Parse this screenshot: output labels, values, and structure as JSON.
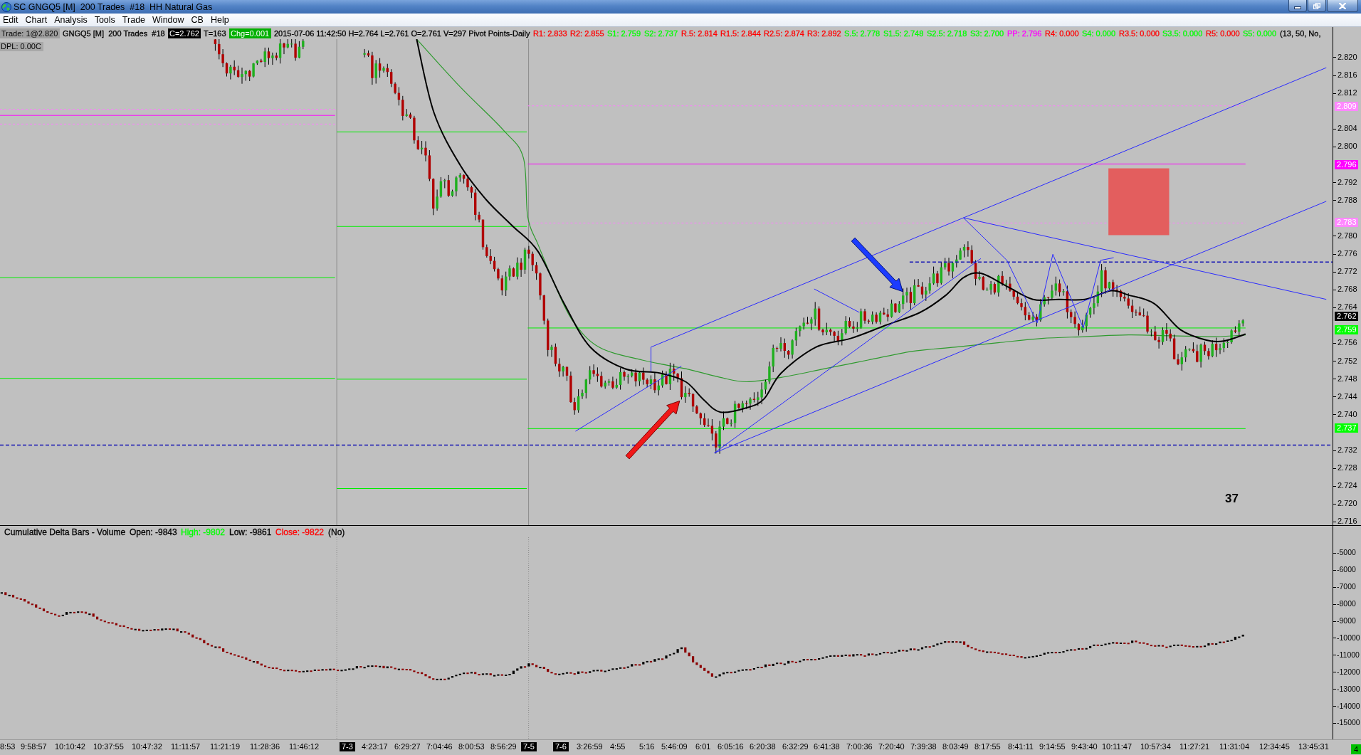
{
  "window": {
    "title": "SC GNGQ5 [M]  200 Trades  #18  HH Natural Gas"
  },
  "menu": [
    "Edit",
    "Chart",
    "Analysis",
    "Tools",
    "Trade",
    "Window",
    "CB",
    "Help"
  ],
  "info_bar": {
    "items": [
      {
        "kind": "label",
        "text": "Trade: 1@2.820",
        "color": "#a0a0a0"
      },
      {
        "kind": "text",
        "text": "GNGQ5 [M]  200 Trades  #18",
        "color": "#000000"
      },
      {
        "kind": "badge",
        "text": "C=2.762",
        "color": "#000000"
      },
      {
        "kind": "text",
        "text": "T=163",
        "color": "#000000"
      },
      {
        "kind": "badge",
        "text": "Chg=0.001",
        "color": "#00b000"
      },
      {
        "kind": "text",
        "text": "2015-07-06 11:42:50 H=2.764 L=2.761 O=2.761 V=297 Pivot Points-Daily",
        "color": "#000000"
      },
      {
        "kind": "text",
        "text": "R1: 2.833",
        "color": "#ff0000"
      },
      {
        "kind": "text",
        "text": "R2: 2.855",
        "color": "#ff0000"
      },
      {
        "kind": "text",
        "text": "S1: 2.759",
        "color": "#00ff00"
      },
      {
        "kind": "text",
        "text": "S2: 2.737",
        "color": "#00ff00"
      },
      {
        "kind": "text",
        "text": "R.5: 2.814",
        "color": "#ff0000"
      },
      {
        "kind": "text",
        "text": "R1.5: 2.844",
        "color": "#ff0000"
      },
      {
        "kind": "text",
        "text": "R2.5: 2.874",
        "color": "#ff0000"
      },
      {
        "kind": "text",
        "text": "R3: 2.892",
        "color": "#ff0000"
      },
      {
        "kind": "text",
        "text": "S.5: 2.778",
        "color": "#00ff00"
      },
      {
        "kind": "text",
        "text": "S1.5: 2.748",
        "color": "#00ff00"
      },
      {
        "kind": "text",
        "text": "S2.5: 2.718",
        "color": "#00ff00"
      },
      {
        "kind": "text",
        "text": "S3: 2.700",
        "color": "#00ff00"
      },
      {
        "kind": "text",
        "text": "PP: 2.796",
        "color": "#ff00ff"
      },
      {
        "kind": "text",
        "text": "R4: 0.000",
        "color": "#ff0000"
      },
      {
        "kind": "text",
        "text": "S4: 0.000",
        "color": "#00ff00"
      },
      {
        "kind": "text",
        "text": "R3.5: 0.000",
        "color": "#ff0000"
      },
      {
        "kind": "text",
        "text": "S3.5: 0.000",
        "color": "#00ff00"
      },
      {
        "kind": "text",
        "text": "R5: 0.000",
        "color": "#ff0000"
      },
      {
        "kind": "text",
        "text": "S5: 0.000",
        "color": "#00ff00"
      },
      {
        "kind": "text",
        "text": "(13, 50, No,",
        "color": "#000000"
      }
    ],
    "dpl": "DPL: 0.00C"
  },
  "price_chart": {
    "annotation": "37",
    "price_axis": {
      "ticks": [
        "2.820",
        "2.816",
        "2.812",
        "2.804",
        "2.800",
        "2.792",
        "2.788",
        "2.780",
        "2.776",
        "2.772",
        "2.768",
        "2.764",
        "2.756",
        "2.752",
        "2.748",
        "2.744",
        "2.740",
        "2.732",
        "2.728",
        "2.724",
        "2.720",
        "2.716"
      ],
      "markers": [
        {
          "text": "2.809",
          "color": "#ff88ff"
        },
        {
          "text": "2.796",
          "color": "#ff00ff"
        },
        {
          "text": "2.783",
          "color": "#ff88ff"
        },
        {
          "text": "2.762",
          "color": "#000000"
        },
        {
          "text": "2.759",
          "color": "#00ff00"
        },
        {
          "text": "2.737",
          "color": "#00ff00"
        }
      ]
    }
  },
  "lower_panel": {
    "header": [
      {
        "text": "Cumulative Delta Bars - Volume",
        "color": "#000000"
      },
      {
        "text": "Open: -9843",
        "color": "#000000"
      },
      {
        "text": "High: -9802",
        "color": "#00ff00"
      },
      {
        "text": "Low: -9861",
        "color": "#000000"
      },
      {
        "text": "Close: -9822",
        "color": "#ff0000"
      },
      {
        "text": "(No)",
        "color": "#000000"
      }
    ],
    "axis_ticks": [
      "-5000",
      "-6000",
      "-7000",
      "-8000",
      "-9000",
      "-10000",
      "-11000",
      "-12000",
      "-13000",
      "-14000",
      "-15000"
    ]
  },
  "time_axis": {
    "labels": [
      {
        "kind": "time",
        "text": "8:53"
      },
      {
        "kind": "time",
        "text": "9:58:57"
      },
      {
        "kind": "time",
        "text": "10:10:42"
      },
      {
        "kind": "time",
        "text": "10:37:55"
      },
      {
        "kind": "time",
        "text": "10:47:32"
      },
      {
        "kind": "time",
        "text": "11:11:57"
      },
      {
        "kind": "time",
        "text": "11:21:19"
      },
      {
        "kind": "time",
        "text": "11:28:36"
      },
      {
        "kind": "time",
        "text": "11:46:12"
      },
      {
        "kind": "date",
        "text": "7-3"
      },
      {
        "kind": "time",
        "text": "4:23:17"
      },
      {
        "kind": "time",
        "text": "6:29:27"
      },
      {
        "kind": "time",
        "text": "7:04:46"
      },
      {
        "kind": "time",
        "text": "8:00:53"
      },
      {
        "kind": "time",
        "text": "8:56:29"
      },
      {
        "kind": "date",
        "text": "7-5"
      },
      {
        "kind": "date",
        "text": "7-6"
      },
      {
        "kind": "time",
        "text": "3:26:59"
      },
      {
        "kind": "time",
        "text": "4:55"
      },
      {
        "kind": "time",
        "text": "5:16"
      },
      {
        "kind": "time",
        "text": "5:46:09"
      },
      {
        "kind": "time",
        "text": "6:01"
      },
      {
        "kind": "time",
        "text": "6:05:16"
      },
      {
        "kind": "time",
        "text": "6:20:38"
      },
      {
        "kind": "time",
        "text": "6:32:29"
      },
      {
        "kind": "time",
        "text": "6:41:38"
      },
      {
        "kind": "time",
        "text": "7:00:36"
      },
      {
        "kind": "time",
        "text": "7:20:40"
      },
      {
        "kind": "time",
        "text": "7:39:38"
      },
      {
        "kind": "time",
        "text": "8:03:49"
      },
      {
        "kind": "time",
        "text": "8:17:55"
      },
      {
        "kind": "time",
        "text": "8:41:11"
      },
      {
        "kind": "time",
        "text": "9:14:55"
      },
      {
        "kind": "time",
        "text": "9:43:40"
      },
      {
        "kind": "time",
        "text": "10:11:47"
      },
      {
        "kind": "time",
        "text": "10:57:34"
      },
      {
        "kind": "time",
        "text": "11:27:21"
      },
      {
        "kind": "time",
        "text": "11:31:04"
      },
      {
        "kind": "time",
        "text": "12:34:45"
      },
      {
        "kind": "time",
        "text": "13:45:31"
      }
    ],
    "corner_badge": "4"
  }
}
